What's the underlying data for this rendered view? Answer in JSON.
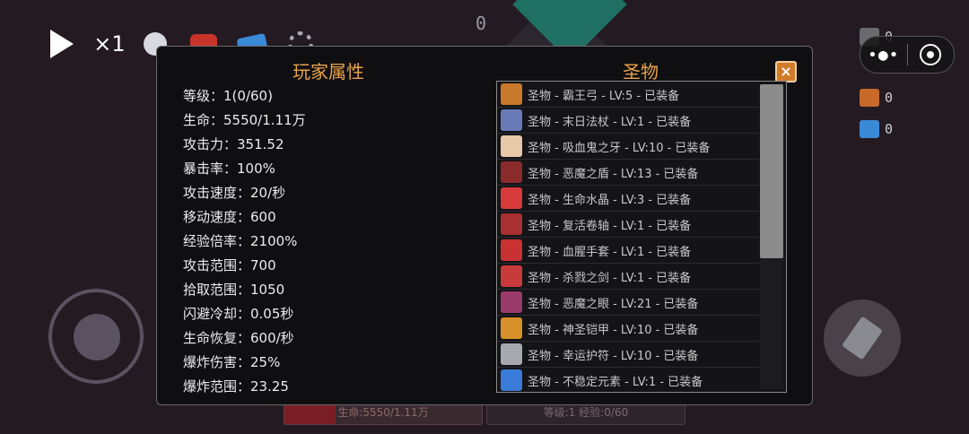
{
  "hud": {
    "score": "0",
    "speed_label": "×1",
    "top_icons": [
      {
        "icon": "skull-relic-icon",
        "color": "#d8d8e0"
      },
      {
        "icon": "crab-demon-icon",
        "color": "#c8342a"
      },
      {
        "icon": "gem-block-icon",
        "color": "#3a8ad8"
      },
      {
        "icon": "gear-relic-icon",
        "color": "#a8a8b0"
      }
    ],
    "counters": [
      {
        "icon": "bomb-icon",
        "color": "#6a6a70",
        "value": "0"
      },
      {
        "icon": "trophy-icon",
        "color": "#c08a3a",
        "value": "0"
      },
      {
        "icon": "potion-icon",
        "color": "#c86a2a",
        "value": "0"
      },
      {
        "icon": "gem-block-icon",
        "color": "#3a8ad8",
        "value": "0"
      }
    ],
    "hp_text": "生命:5550/1.11万",
    "level_text": "等级:1 经验:0/60"
  },
  "panel": {
    "left_title": "玩家属性",
    "right_title": "圣物",
    "close_label": "×",
    "stats": [
      "等级：1(0/60)",
      "生命：5550/1.11万",
      "攻击力：351.52",
      "暴击率：100%",
      "攻击速度：20/秒",
      "移动速度：600",
      "经验倍率：2100%",
      "攻击范围：700",
      "拾取范围：1050",
      "闪避冷却：0.05秒",
      "生命恢复：600/秒",
      "爆炸伤害：25%",
      "爆炸范围：23.25"
    ],
    "relics": [
      {
        "text": "圣物 - 霸王弓 - LV:5 - 已装备",
        "icon": "bow-icon",
        "color": "#c87a2a"
      },
      {
        "text": "圣物 - 末日法杖 - LV:1 - 已装备",
        "icon": "staff-icon",
        "color": "#6a7ab8"
      },
      {
        "text": "圣物 - 吸血鬼之牙 - LV:10 - 已装备",
        "icon": "fang-icon",
        "color": "#e8c8a8"
      },
      {
        "text": "圣物 - 恶魔之盾 - LV:13 - 已装备",
        "icon": "shield-icon",
        "color": "#8a2a2a"
      },
      {
        "text": "圣物 - 生命水晶 - LV:3 - 已装备",
        "icon": "crystal-icon",
        "color": "#d83a3a"
      },
      {
        "text": "圣物 - 复活卷轴 - LV:1 - 已装备",
        "icon": "scroll-icon",
        "color": "#a83030"
      },
      {
        "text": "圣物 - 血腥手套 - LV:1 - 已装备",
        "icon": "glove-icon",
        "color": "#c83232"
      },
      {
        "text": "圣物 - 杀戮之剑 - LV:1 - 已装备",
        "icon": "sword-icon",
        "color": "#c83a3a"
      },
      {
        "text": "圣物 - 恶魔之眼 - LV:21 - 已装备",
        "icon": "eye-icon",
        "color": "#9a3a6a"
      },
      {
        "text": "圣物 - 神圣铠甲 - LV:10 - 已装备",
        "icon": "armor-icon",
        "color": "#d8902a"
      },
      {
        "text": "圣物 - 幸运护符 - LV:10 - 已装备",
        "icon": "amulet-icon",
        "color": "#a8a8b0"
      },
      {
        "text": "圣物 - 不稳定元素 - LV:1 - 已装备",
        "icon": "element-icon",
        "color": "#3a7ad8"
      }
    ]
  },
  "colors": {
    "title": "#e8a24a",
    "panel_bg": "#0f0f12",
    "accent_teal": "#1f7a6a"
  }
}
